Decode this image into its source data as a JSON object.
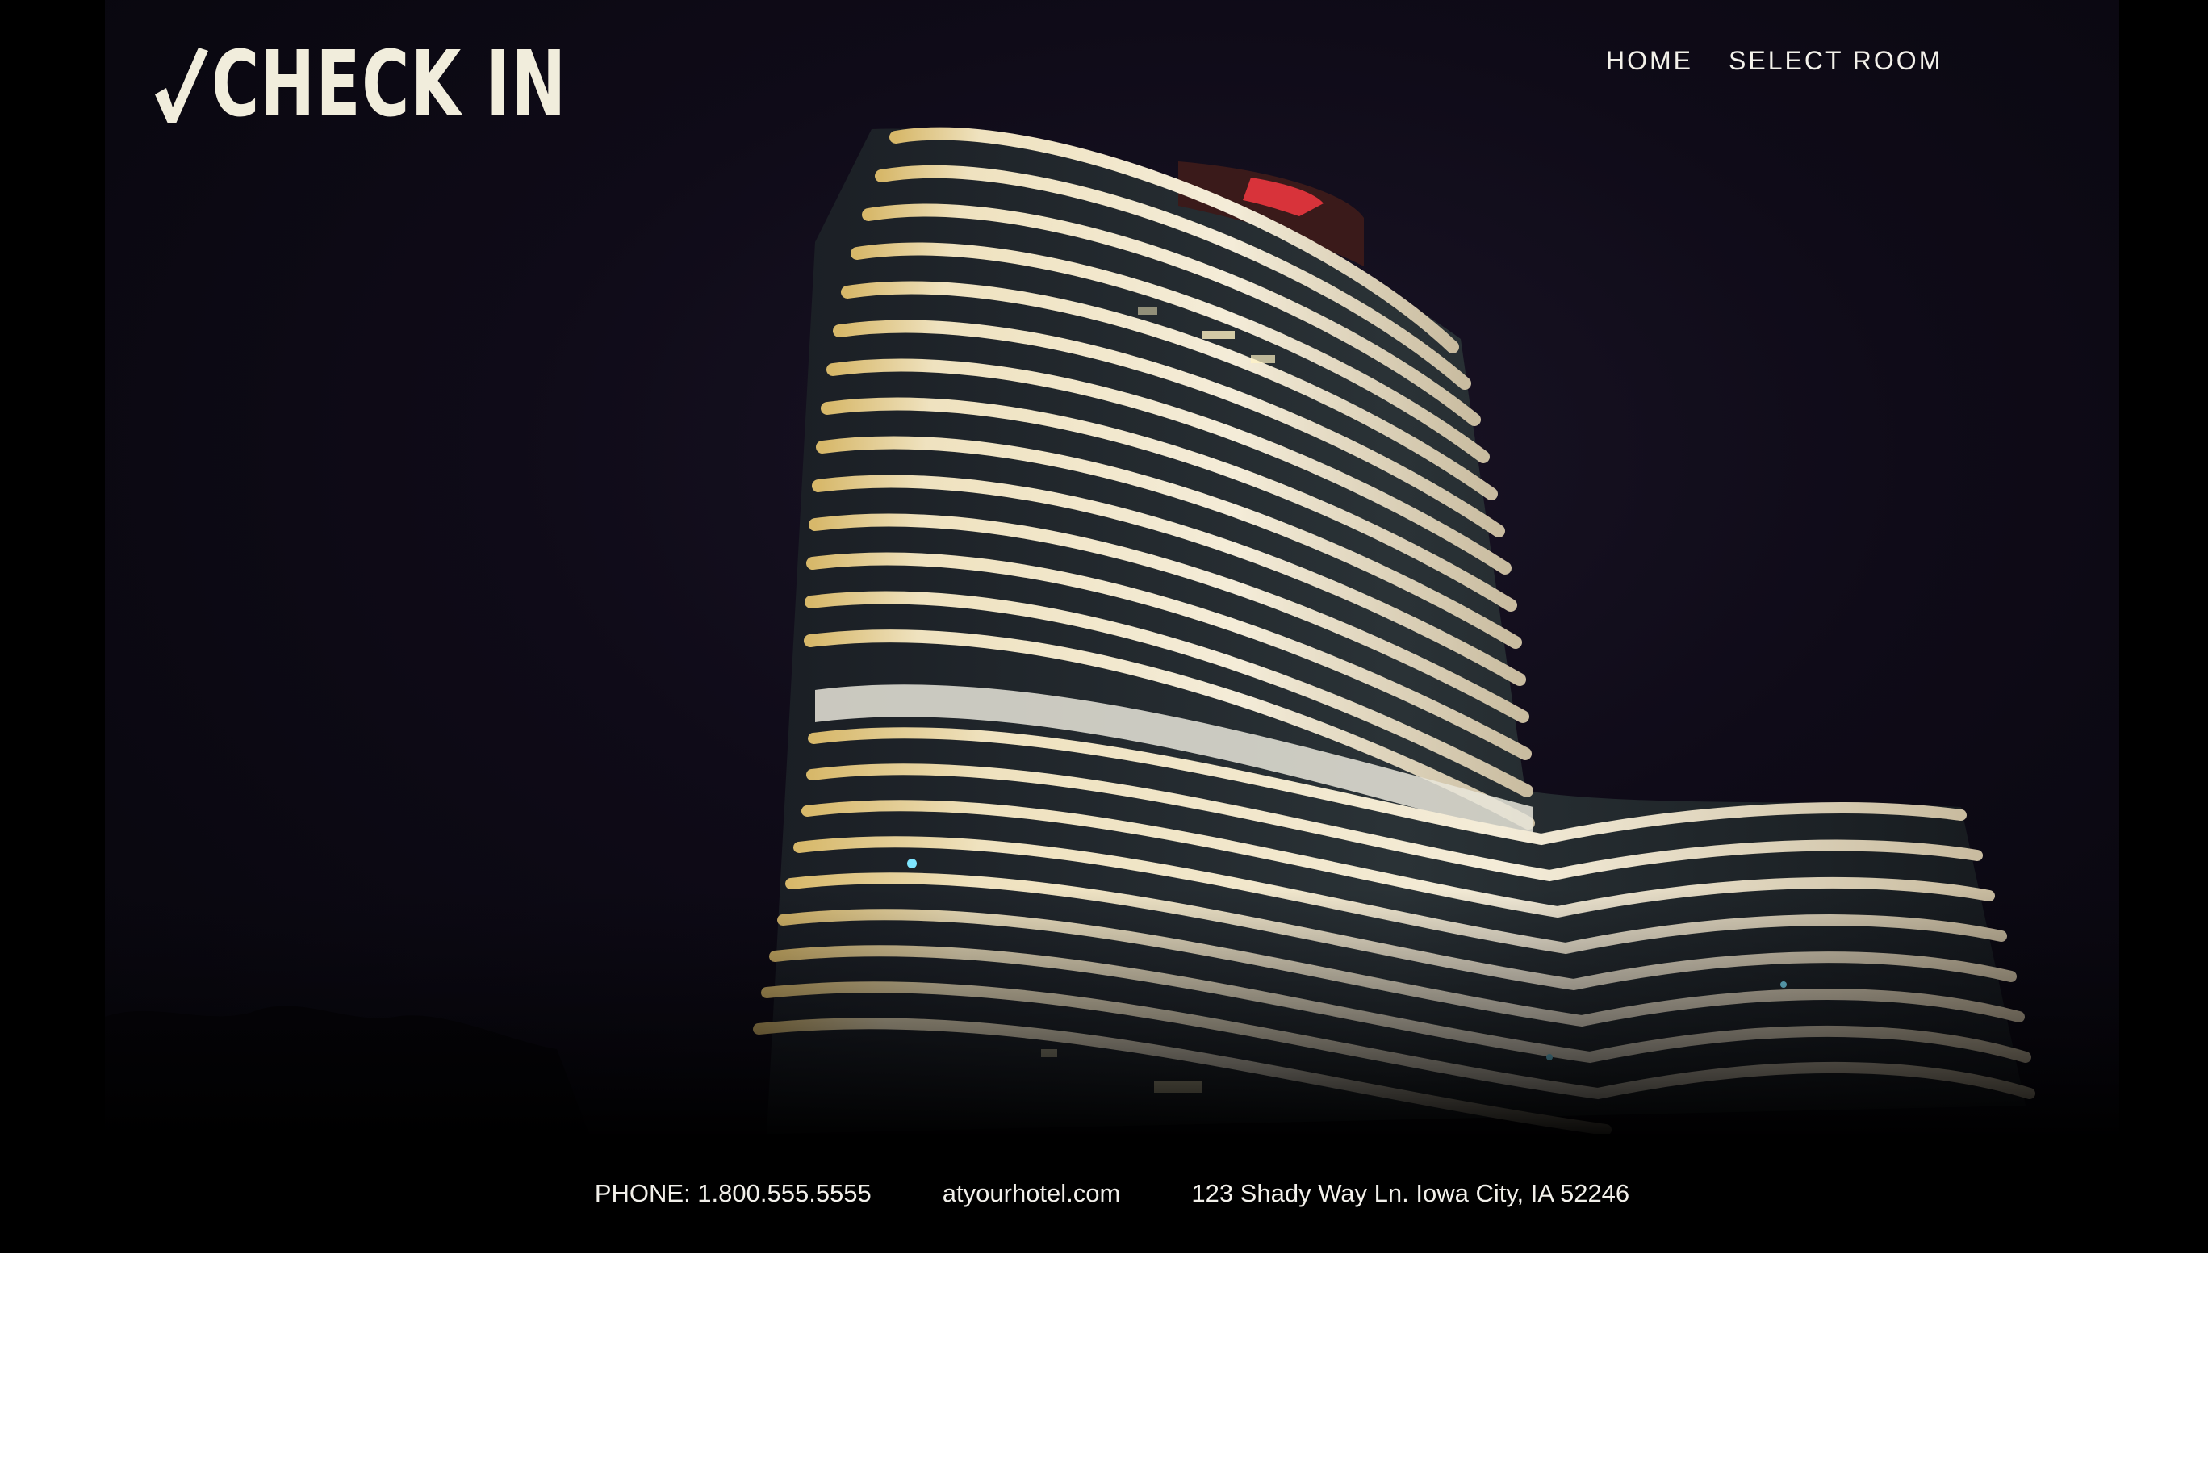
{
  "brand": {
    "name": "CHECK IN",
    "logo_icon": "checkmark-icon",
    "text_color": "#f1eddc"
  },
  "nav": {
    "items": [
      {
        "label": "HOME"
      },
      {
        "label": "SELECT ROOM"
      }
    ]
  },
  "hero": {
    "image_subject": "curved-hotel-tower-at-night",
    "background_color": "#0f0b18",
    "accent_color": "#f2ead2"
  },
  "contact": {
    "phone": "PHONE: 1.800.555.5555",
    "website": "atyourhotel.com",
    "address": "123 Shady Way Ln. Iowa City, IA 52246"
  }
}
